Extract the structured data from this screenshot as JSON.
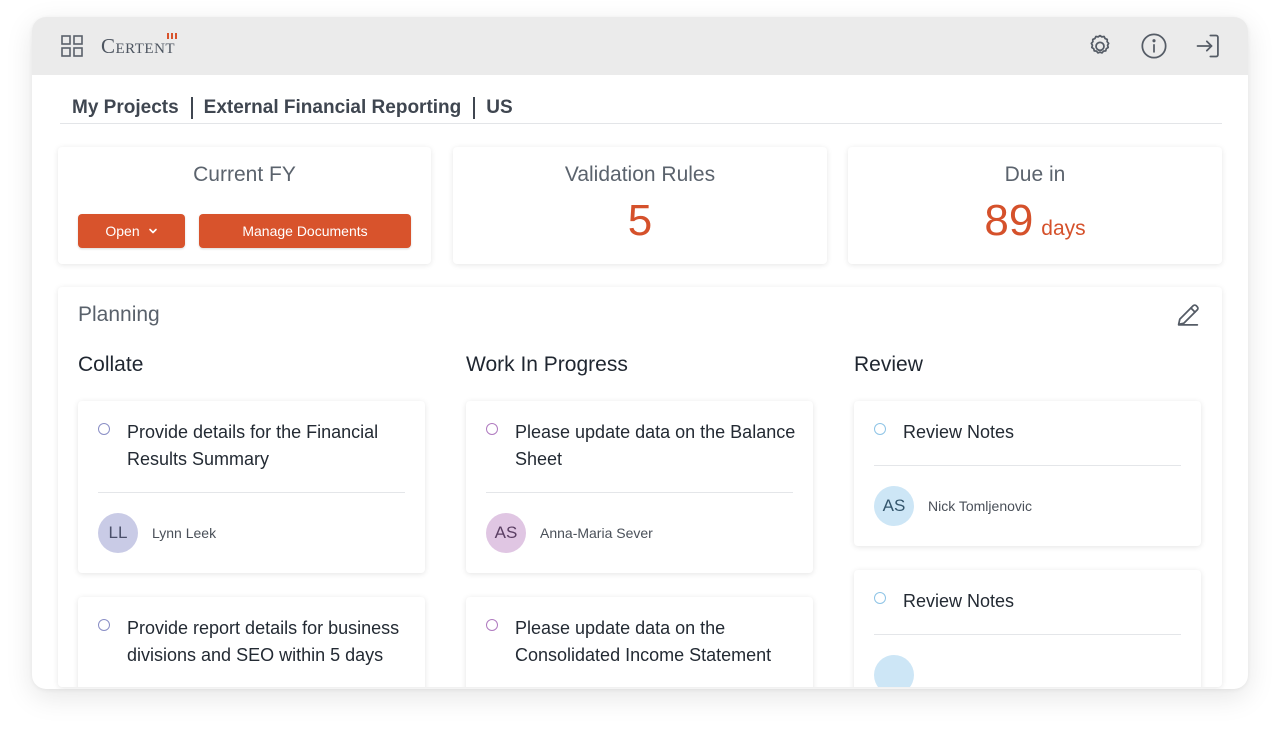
{
  "app": {
    "logo_text": "Certent",
    "brand_color": "#d8532c"
  },
  "topbar": {
    "icons": [
      "grid-icon",
      "gear-icon",
      "info-icon",
      "logout-icon"
    ]
  },
  "breadcrumb": [
    "My Projects",
    "External Financial Reporting",
    "US"
  ],
  "cards": {
    "current_fy": {
      "title": "Current FY",
      "status_button": "Open",
      "manage_button": "Manage Documents"
    },
    "validation_rules": {
      "title": "Validation Rules",
      "value": "5"
    },
    "due_in": {
      "title": "Due in",
      "value": "89",
      "unit": "days"
    }
  },
  "planning": {
    "title": "Planning",
    "columns": [
      {
        "title": "Collate",
        "tasks": [
          {
            "text": "Provide details for the Financial Results Summary",
            "initials": "LL",
            "assignee": "Lynn Leek"
          },
          {
            "text": "Provide report details for business divisions and SEO within 5 days"
          }
        ]
      },
      {
        "title": "Work In Progress",
        "tasks": [
          {
            "text": "Please update data on the Balance Sheet",
            "initials": "AS",
            "assignee": "Anna-Maria Sever"
          },
          {
            "text": "Please update data on the Consolidated Income Statement"
          }
        ]
      },
      {
        "title": "Review",
        "tasks": [
          {
            "text": "Review Notes",
            "initials": "AS",
            "assignee": "Nick Tomljenovic"
          },
          {
            "text": "Review Notes"
          }
        ]
      }
    ]
  }
}
